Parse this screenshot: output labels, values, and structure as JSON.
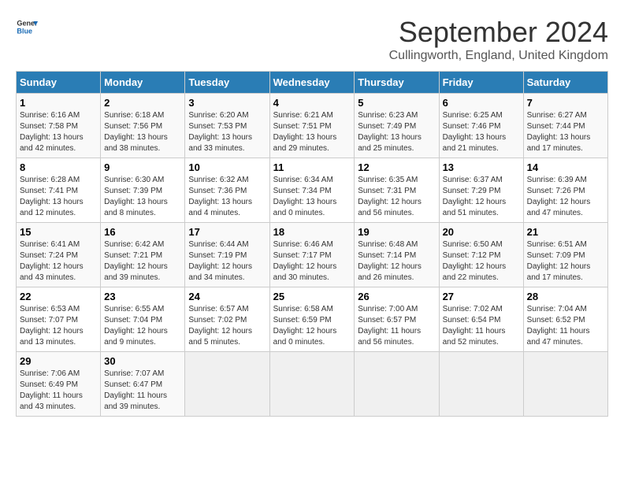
{
  "header": {
    "logo_line1": "General",
    "logo_line2": "Blue",
    "title": "September 2024",
    "subtitle": "Cullingworth, England, United Kingdom"
  },
  "weekdays": [
    "Sunday",
    "Monday",
    "Tuesday",
    "Wednesday",
    "Thursday",
    "Friday",
    "Saturday"
  ],
  "weeks": [
    [
      {
        "day": "1",
        "info": "Sunrise: 6:16 AM\nSunset: 7:58 PM\nDaylight: 13 hours\nand 42 minutes."
      },
      {
        "day": "2",
        "info": "Sunrise: 6:18 AM\nSunset: 7:56 PM\nDaylight: 13 hours\nand 38 minutes."
      },
      {
        "day": "3",
        "info": "Sunrise: 6:20 AM\nSunset: 7:53 PM\nDaylight: 13 hours\nand 33 minutes."
      },
      {
        "day": "4",
        "info": "Sunrise: 6:21 AM\nSunset: 7:51 PM\nDaylight: 13 hours\nand 29 minutes."
      },
      {
        "day": "5",
        "info": "Sunrise: 6:23 AM\nSunset: 7:49 PM\nDaylight: 13 hours\nand 25 minutes."
      },
      {
        "day": "6",
        "info": "Sunrise: 6:25 AM\nSunset: 7:46 PM\nDaylight: 13 hours\nand 21 minutes."
      },
      {
        "day": "7",
        "info": "Sunrise: 6:27 AM\nSunset: 7:44 PM\nDaylight: 13 hours\nand 17 minutes."
      }
    ],
    [
      {
        "day": "8",
        "info": "Sunrise: 6:28 AM\nSunset: 7:41 PM\nDaylight: 13 hours\nand 12 minutes."
      },
      {
        "day": "9",
        "info": "Sunrise: 6:30 AM\nSunset: 7:39 PM\nDaylight: 13 hours\nand 8 minutes."
      },
      {
        "day": "10",
        "info": "Sunrise: 6:32 AM\nSunset: 7:36 PM\nDaylight: 13 hours\nand 4 minutes."
      },
      {
        "day": "11",
        "info": "Sunrise: 6:34 AM\nSunset: 7:34 PM\nDaylight: 13 hours\nand 0 minutes."
      },
      {
        "day": "12",
        "info": "Sunrise: 6:35 AM\nSunset: 7:31 PM\nDaylight: 12 hours\nand 56 minutes."
      },
      {
        "day": "13",
        "info": "Sunrise: 6:37 AM\nSunset: 7:29 PM\nDaylight: 12 hours\nand 51 minutes."
      },
      {
        "day": "14",
        "info": "Sunrise: 6:39 AM\nSunset: 7:26 PM\nDaylight: 12 hours\nand 47 minutes."
      }
    ],
    [
      {
        "day": "15",
        "info": "Sunrise: 6:41 AM\nSunset: 7:24 PM\nDaylight: 12 hours\nand 43 minutes."
      },
      {
        "day": "16",
        "info": "Sunrise: 6:42 AM\nSunset: 7:21 PM\nDaylight: 12 hours\nand 39 minutes."
      },
      {
        "day": "17",
        "info": "Sunrise: 6:44 AM\nSunset: 7:19 PM\nDaylight: 12 hours\nand 34 minutes."
      },
      {
        "day": "18",
        "info": "Sunrise: 6:46 AM\nSunset: 7:17 PM\nDaylight: 12 hours\nand 30 minutes."
      },
      {
        "day": "19",
        "info": "Sunrise: 6:48 AM\nSunset: 7:14 PM\nDaylight: 12 hours\nand 26 minutes."
      },
      {
        "day": "20",
        "info": "Sunrise: 6:50 AM\nSunset: 7:12 PM\nDaylight: 12 hours\nand 22 minutes."
      },
      {
        "day": "21",
        "info": "Sunrise: 6:51 AM\nSunset: 7:09 PM\nDaylight: 12 hours\nand 17 minutes."
      }
    ],
    [
      {
        "day": "22",
        "info": "Sunrise: 6:53 AM\nSunset: 7:07 PM\nDaylight: 12 hours\nand 13 minutes."
      },
      {
        "day": "23",
        "info": "Sunrise: 6:55 AM\nSunset: 7:04 PM\nDaylight: 12 hours\nand 9 minutes."
      },
      {
        "day": "24",
        "info": "Sunrise: 6:57 AM\nSunset: 7:02 PM\nDaylight: 12 hours\nand 5 minutes."
      },
      {
        "day": "25",
        "info": "Sunrise: 6:58 AM\nSunset: 6:59 PM\nDaylight: 12 hours\nand 0 minutes."
      },
      {
        "day": "26",
        "info": "Sunrise: 7:00 AM\nSunset: 6:57 PM\nDaylight: 11 hours\nand 56 minutes."
      },
      {
        "day": "27",
        "info": "Sunrise: 7:02 AM\nSunset: 6:54 PM\nDaylight: 11 hours\nand 52 minutes."
      },
      {
        "day": "28",
        "info": "Sunrise: 7:04 AM\nSunset: 6:52 PM\nDaylight: 11 hours\nand 47 minutes."
      }
    ],
    [
      {
        "day": "29",
        "info": "Sunrise: 7:06 AM\nSunset: 6:49 PM\nDaylight: 11 hours\nand 43 minutes."
      },
      {
        "day": "30",
        "info": "Sunrise: 7:07 AM\nSunset: 6:47 PM\nDaylight: 11 hours\nand 39 minutes."
      },
      {
        "day": "",
        "info": "",
        "empty": true
      },
      {
        "day": "",
        "info": "",
        "empty": true
      },
      {
        "day": "",
        "info": "",
        "empty": true
      },
      {
        "day": "",
        "info": "",
        "empty": true
      },
      {
        "day": "",
        "info": "",
        "empty": true
      }
    ]
  ]
}
